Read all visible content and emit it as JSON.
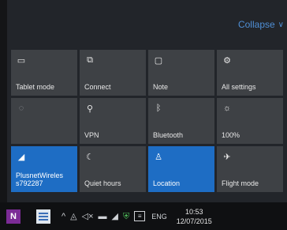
{
  "header": {
    "collapse_label": "Collapse",
    "collapse_icon": "chevron-down-icon"
  },
  "tiles": [
    {
      "label": "Tablet mode",
      "icon": "tablet-mode-icon",
      "glyph": "▭",
      "state": "off"
    },
    {
      "label": "Connect",
      "icon": "connect-icon",
      "glyph": "⧉",
      "state": "off"
    },
    {
      "label": "Note",
      "icon": "note-icon",
      "glyph": "▢",
      "state": "off"
    },
    {
      "label": "All settings",
      "icon": "gear-icon",
      "glyph": "⚙",
      "state": "off"
    },
    {
      "label": "",
      "icon": "battery-saver-icon",
      "glyph": "◌",
      "state": "disabled"
    },
    {
      "label": "VPN",
      "icon": "vpn-icon",
      "glyph": "⚲",
      "state": "off"
    },
    {
      "label": "Bluetooth",
      "icon": "bluetooth-icon",
      "glyph": "ᛒ",
      "state": "off"
    },
    {
      "label": "100%",
      "icon": "brightness-icon",
      "glyph": "☼",
      "state": "off"
    },
    {
      "label": "PlusnetWireles\ns792287",
      "icon": "wifi-icon",
      "glyph": "◢",
      "state": "active"
    },
    {
      "label": "Quiet hours",
      "icon": "moon-icon",
      "glyph": "☾",
      "state": "off"
    },
    {
      "label": "Location",
      "icon": "location-icon",
      "glyph": "♙",
      "state": "active"
    },
    {
      "label": "Flight mode",
      "icon": "airplane-icon",
      "glyph": "✈",
      "state": "off"
    }
  ],
  "taskbar": {
    "apps": [
      {
        "name": "onenote",
        "icon": "onenote-icon",
        "glyph": "N"
      },
      {
        "name": "notes",
        "icon": "notepad-icon",
        "glyph": ""
      }
    ],
    "tray": [
      {
        "icon": "chevron-up-icon",
        "glyph": "^"
      },
      {
        "icon": "network-icon",
        "glyph": "◬"
      },
      {
        "icon": "volume-icon",
        "glyph": "◁×"
      },
      {
        "icon": "battery-icon",
        "glyph": "▬"
      },
      {
        "icon": "wifi-tray-icon",
        "glyph": "◢"
      },
      {
        "icon": "store-icon",
        "glyph": "⛨",
        "color": "#4fbf5a"
      },
      {
        "icon": "action-center-icon",
        "glyph": "≡"
      }
    ],
    "language": "ENG",
    "time": "10:53",
    "date": "12/07/2015"
  }
}
